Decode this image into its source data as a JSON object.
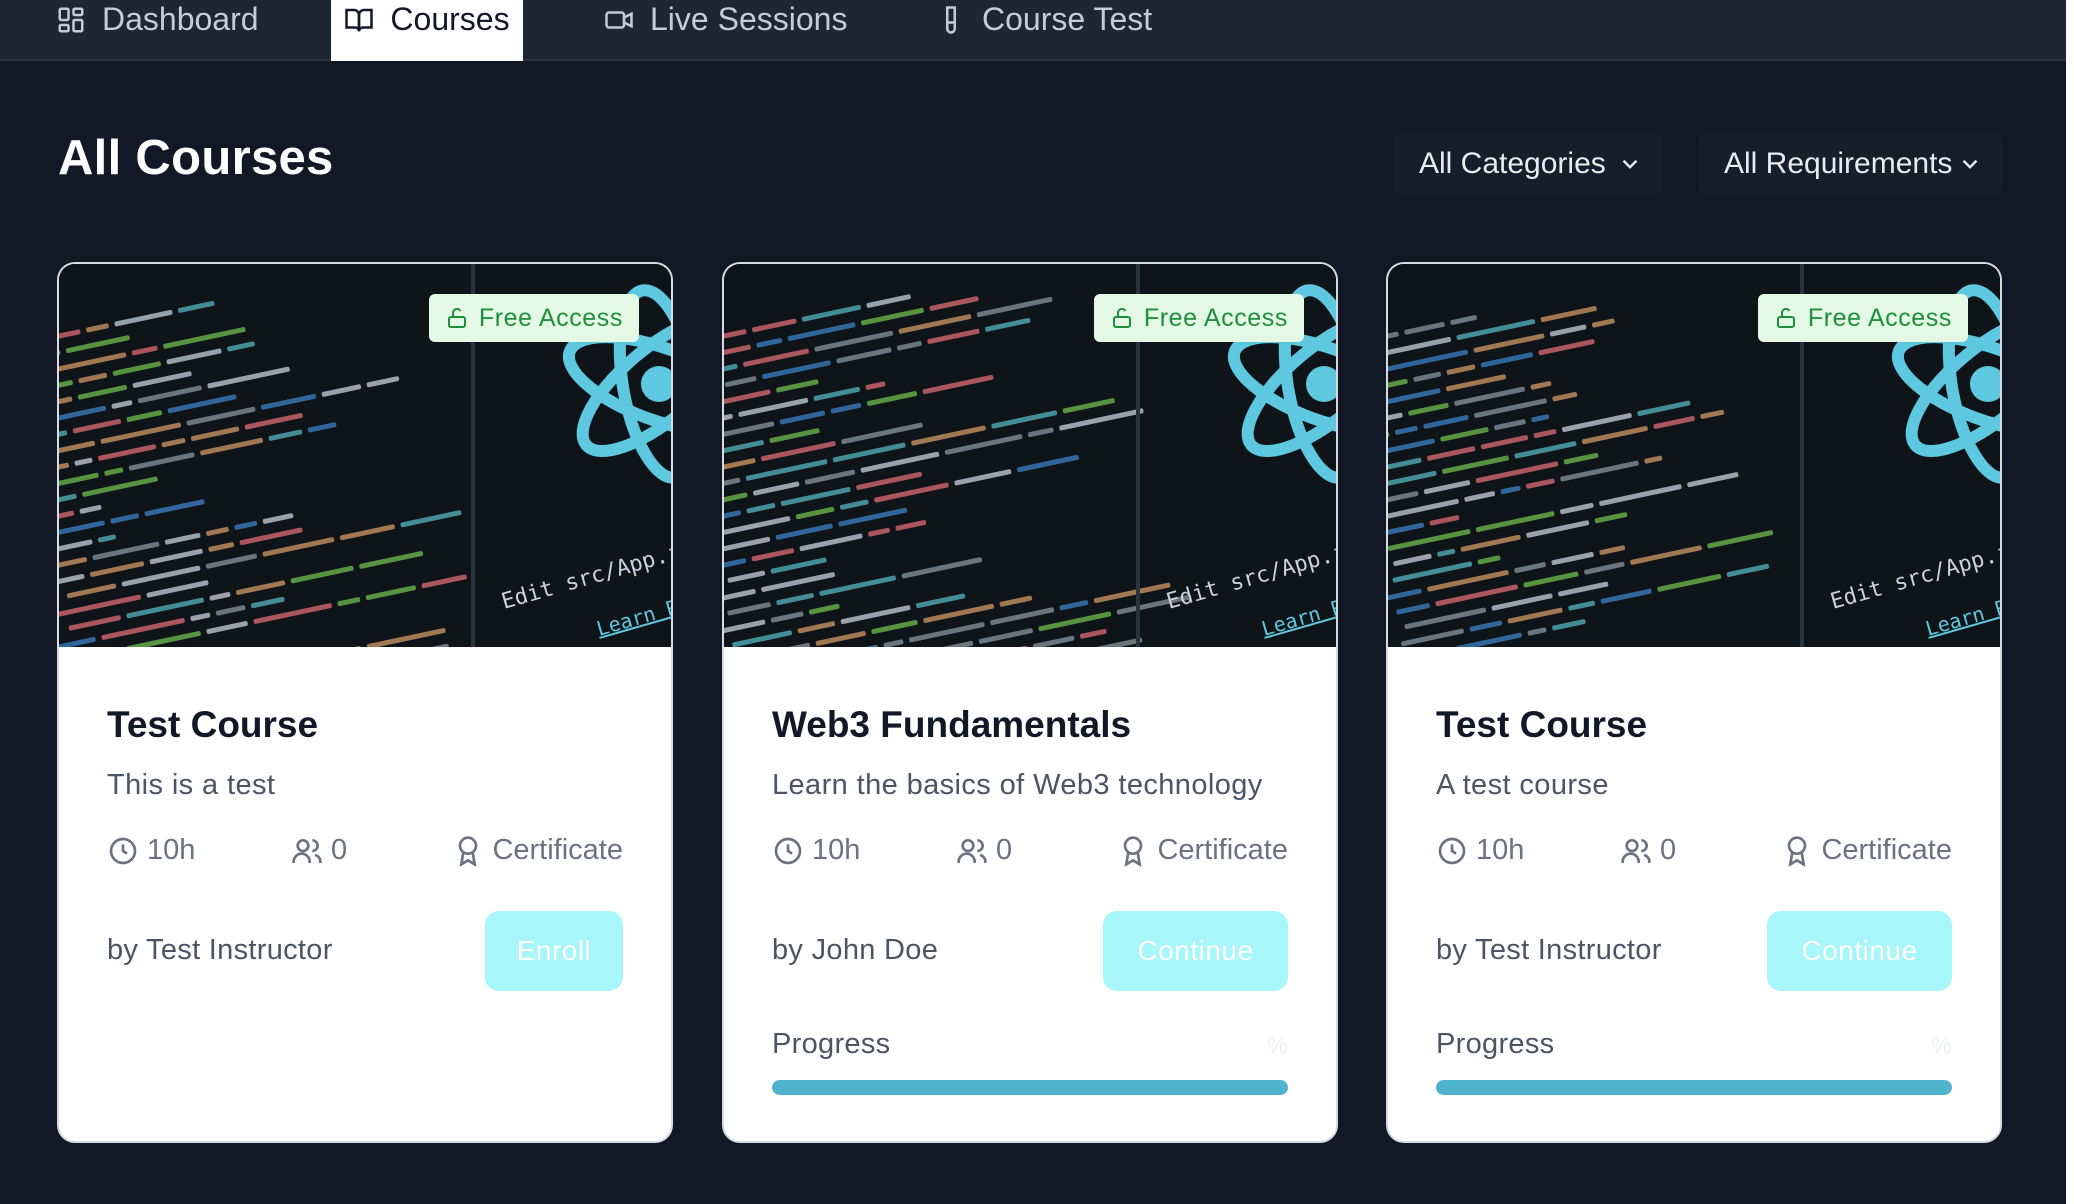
{
  "nav": {
    "items": [
      {
        "label": "Dashboard",
        "icon": "dashboard-icon"
      },
      {
        "label": "Courses",
        "icon": "book-icon",
        "active": true
      },
      {
        "label": "Live Sessions",
        "icon": "video-icon"
      },
      {
        "label": "Course Test",
        "icon": "test-tube-icon"
      }
    ]
  },
  "header": {
    "title": "All Courses",
    "filters": {
      "category": "All Categories",
      "requirement": "All Requirements"
    }
  },
  "cards": [
    {
      "badge": "Free Access",
      "title": "Test Course",
      "description": "This is a test",
      "duration": "10h",
      "students": "0",
      "certificate": "Certificate",
      "instructor": "by Test Instructor",
      "action": "Enroll"
    },
    {
      "badge": "Free Access",
      "title": "Web3 Fundamentals",
      "description": "Learn the basics of Web3 technology",
      "duration": "10h",
      "students": "0",
      "certificate": "Certificate",
      "instructor": "by John Doe",
      "action": "Continue",
      "progress_label": "Progress",
      "progress_percent_text": "%",
      "progress_fraction": 1.0
    },
    {
      "badge": "Free Access",
      "title": "Test Course",
      "description": "A test course",
      "duration": "10h",
      "students": "0",
      "certificate": "Certificate",
      "instructor": "by Test Instructor",
      "action": "Continue",
      "progress_label": "Progress",
      "progress_percent_text": "%",
      "progress_fraction": 1.0
    }
  ],
  "thumbnail": {
    "code_text_1": "Edit src/App.js and",
    "code_text_2": "Learn Re"
  },
  "colors": {
    "background": "#121826",
    "nav_background": "#1f2633",
    "card_background": "#ffffff",
    "badge_background": "#e3f9e6",
    "badge_text": "#1f8f3c",
    "button_background": "#a7f7fa",
    "progress_fill": "#4fb3cd",
    "react_logo": "#5ec8e0"
  }
}
